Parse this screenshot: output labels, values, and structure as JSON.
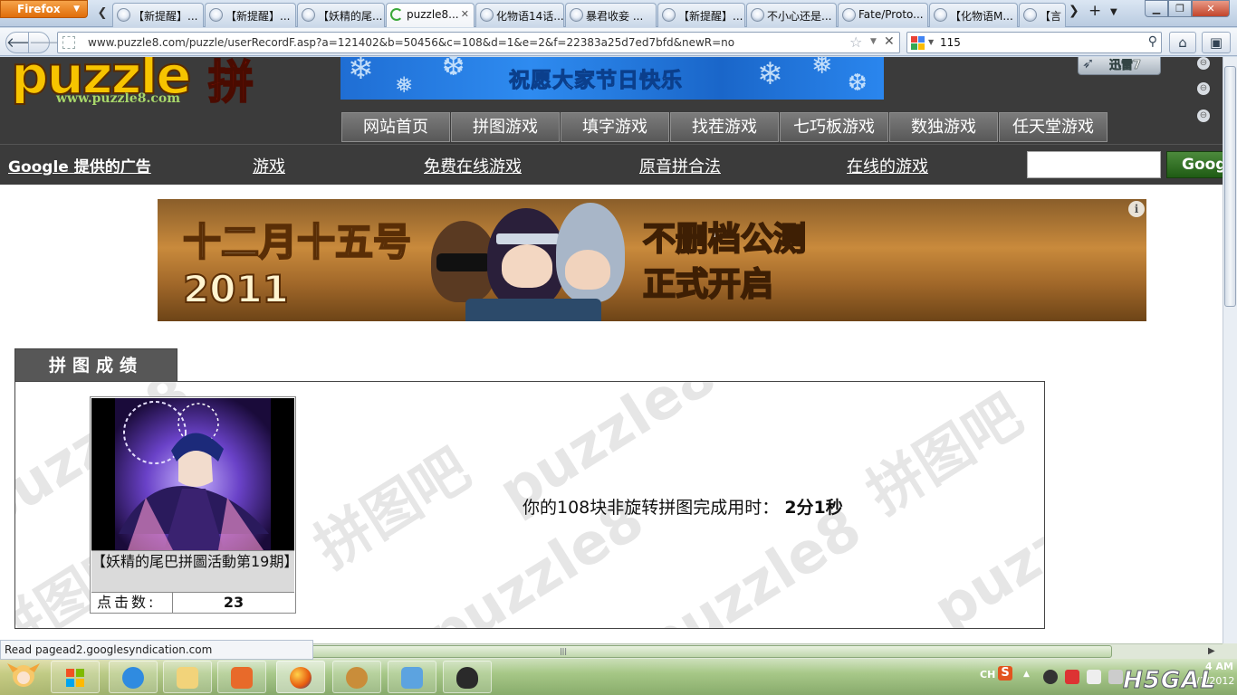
{
  "browser": {
    "menu_label": "Firefox",
    "tabs": [
      {
        "label": "【新提醒】...",
        "active": false
      },
      {
        "label": "【新提醒】...",
        "active": false
      },
      {
        "label": "【妖精的尾...",
        "active": false
      },
      {
        "label": "puzzle8...",
        "active": true
      },
      {
        "label": "化物语14话...",
        "active": false
      },
      {
        "label": "暴君收妾 ...",
        "active": false
      },
      {
        "label": "【新提醒】...",
        "active": false
      },
      {
        "label": "不小心还是...",
        "active": false
      },
      {
        "label": "Fate/Proto...",
        "active": false
      },
      {
        "label": "【化物语M...",
        "active": false
      },
      {
        "label": "【言",
        "active": false
      }
    ],
    "url": "www.puzzle8.com/puzzle/userRecordF.asp?a=121402&b=50456&c=108&d=1&e=2&f=22383a25d7ed7bfd&newR=no",
    "search_query": "115",
    "status_text": "Read pagead2.googlesyndication.com"
  },
  "site": {
    "logo_text": "puzzle",
    "logo_cn": "拼",
    "logo_url": "www.puzzle8.com",
    "top_banner_text": "祝愿大家节日快乐",
    "xunlei_label": "迅雷7",
    "nav": [
      "网站首页",
      "拼图游戏",
      "填字游戏",
      "找茬游戏",
      "七巧板游戏",
      "数独游戏",
      "任天堂游戏"
    ],
    "ad_bar": {
      "google_label": "Google 提供的广告",
      "links": [
        "游戏",
        "免费在线游戏",
        "原音拼合法",
        "在线的游戏"
      ],
      "search_button": "Goog"
    },
    "main_banner": {
      "date_line1": "十二月十五号",
      "date_line2": "2011",
      "slogan_line1": "不删档公测",
      "slogan_line2": "正式开启",
      "info_icon": "i"
    }
  },
  "record": {
    "tab_title": "拼图成绩",
    "watermark": [
      "puzzle8",
      "拼图吧"
    ],
    "puzzle_title": "【妖精的尾巴拼圖活動第19期】",
    "clicks_label": "点击数:",
    "clicks_value": "23",
    "result_prefix": "你的108块非旋转拼图完成用时：",
    "result_time": "2分1秒"
  },
  "taskbar": {
    "tray_lang": "CH",
    "tray_sogou": "S",
    "time": "4 AM",
    "date": "2/1/2012",
    "overlay_logo": "H5GAL"
  }
}
